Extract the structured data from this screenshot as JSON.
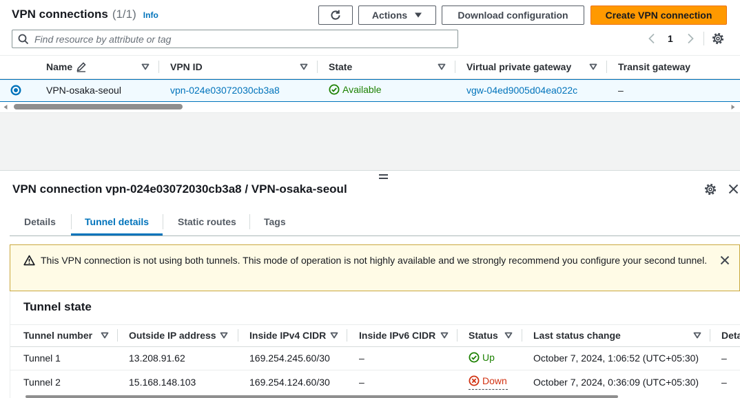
{
  "header": {
    "title": "VPN connections",
    "count": "(1/1)",
    "info": "Info"
  },
  "toolbar": {
    "refresh_icon": "refresh-icon",
    "actions_label": "Actions",
    "download_label": "Download configuration",
    "create_label": "Create VPN connection"
  },
  "search": {
    "placeholder": "Find resource by attribute or tag",
    "value": "",
    "icon": "search-icon"
  },
  "pagination": {
    "current_page": "1"
  },
  "connections_table": {
    "columns": [
      "Name",
      "VPN ID",
      "State",
      "Virtual private gateway",
      "Transit gateway"
    ],
    "rows": [
      {
        "selected": true,
        "name": "VPN-osaka-seoul",
        "vpn_id": "vpn-024e03072030cb3a8",
        "state": "Available",
        "virtual_private_gateway": "vgw-04ed9005d04ea022c",
        "transit_gateway": "–"
      }
    ]
  },
  "detail_panel": {
    "title": "VPN connection vpn-024e03072030cb3a8 / VPN-osaka-seoul",
    "tabs": [
      {
        "label": "Details"
      },
      {
        "label": "Tunnel details",
        "active": true
      },
      {
        "label": "Static routes"
      },
      {
        "label": "Tags"
      }
    ]
  },
  "alert": {
    "icon": "warning-icon",
    "text": "This VPN connection is not using both tunnels. This mode of operation is not highly available and we strongly recommend you configure your second tunnel."
  },
  "tunnel_state": {
    "heading": "Tunnel state",
    "columns": [
      "Tunnel number",
      "Outside IP address",
      "Inside IPv4 CIDR",
      "Inside IPv6 CIDR",
      "Status",
      "Last status change",
      "Deta"
    ],
    "rows": [
      {
        "tunnel_number": "Tunnel 1",
        "outside_ip": "13.208.91.62",
        "inside_ipv4": "169.254.245.60/30",
        "inside_ipv6": "–",
        "status": "Up",
        "status_icon": "check-circle-icon",
        "last_status_change": "October 7, 2024, 1:06:52 (UTC+05:30)",
        "details": "–"
      },
      {
        "tunnel_number": "Tunnel 2",
        "outside_ip": "15.168.148.103",
        "inside_ipv4": "169.254.124.60/30",
        "inside_ipv6": "–",
        "status": "Down",
        "status_icon": "x-circle-icon",
        "last_status_change": "October 7, 2024, 0:36:09 (UTC+05:30)",
        "details": "–"
      }
    ]
  },
  "colors": {
    "link": "#0073bb",
    "success": "#1d8102",
    "error": "#d13212",
    "primary_button": "#ff9900",
    "selected_row": "#f1faff"
  }
}
